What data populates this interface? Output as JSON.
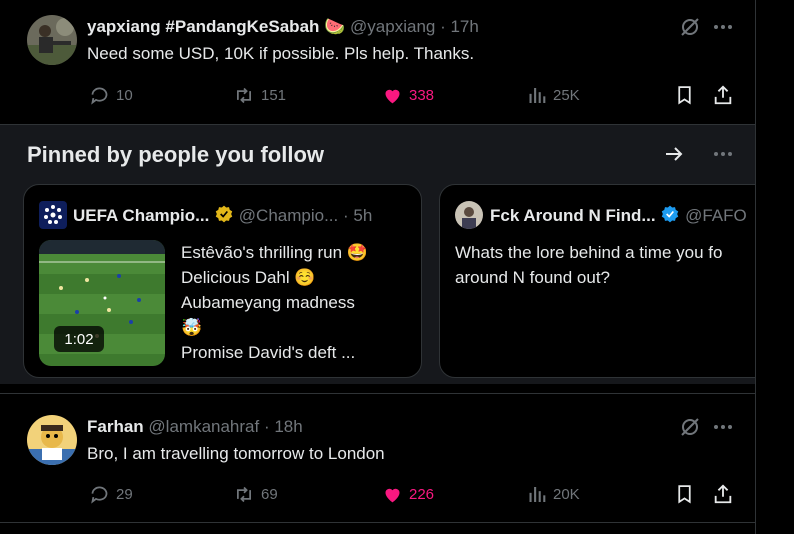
{
  "tweets": [
    {
      "name": "yapxiang #PandangKeSabah",
      "name_emoji": "🍉",
      "handle": "@yapxiang",
      "time": "· 17h",
      "text": "Need some USD, 10K if possible. Pls help. Thanks.",
      "replies": "10",
      "reposts": "151",
      "likes": "338",
      "views": "25K"
    },
    {
      "name": "Farhan",
      "handle": "@lamkanahraf",
      "time": "· 18h",
      "text": "Bro, I am travelling tomorrow to London",
      "replies": "29",
      "reposts": "69",
      "likes": "226",
      "views": "20K"
    }
  ],
  "pinned": {
    "title": "Pinned by people you follow",
    "cards": [
      {
        "name": "UEFA Champio...",
        "handle": "@Champio...",
        "time": "· 5h",
        "lines": [
          "Estêvão's thrilling run 🤩",
          "Delicious Dahl ☺️",
          "Aubameyang madness",
          "🤯",
          "Promise David's deft ..."
        ],
        "video_duration": "1:02"
      },
      {
        "name": "Fck Around N Find...",
        "handle": "@FAFO",
        "lines": [
          "Whats the lore behind a time you fo",
          "around N found out?"
        ]
      }
    ]
  },
  "colors": {
    "like": "#f91880",
    "muted": "#71767b",
    "verified_gold": "#e2b719",
    "verified_blue": "#1d9bf0"
  }
}
